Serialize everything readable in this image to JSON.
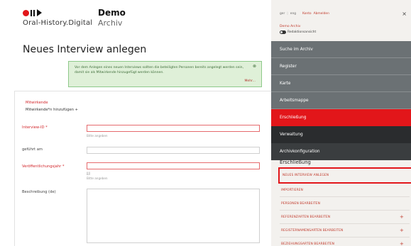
{
  "header": {
    "logo_text": "Oral-History.Digital",
    "archive_title": "Demo",
    "archive_subtitle": "Archiv"
  },
  "main": {
    "page_title": "Neues Interview anlegen",
    "notice": {
      "text": "Vor dem Anlegen eines neuen Interviews sollten die beteiligten Personen bereits angelegt werden sein, damit sie als Mitwirkende hinzugefügt werden können.",
      "more": "Mehr..."
    },
    "mitarbeitende": {
      "label": "Mitwirkende",
      "add_label": "Mitwirkende*n hinzufügen +"
    },
    "interview_id": {
      "label": "Interview-ID *",
      "value": "",
      "hint": "Bitte angeben"
    },
    "gefuehrt_am": {
      "label": "geführt am",
      "value": ""
    },
    "veroeffentlichungsjahr": {
      "label": "Veröffentlichungsjahr *",
      "value": "",
      "hint1": "JJJJ",
      "hint2": "Bitte angeben"
    },
    "beschreibung": {
      "label": "Beschreibung (de)",
      "value": ""
    }
  },
  "sidebar": {
    "lang_de": "ger",
    "lang_en": "eng",
    "login": "Konto",
    "logout": "Abmelden",
    "close": "×",
    "archive_name": "Demo Archiv",
    "toggle_label": "Redaktionsansicht",
    "nav": [
      {
        "label": "Suche im Archiv"
      },
      {
        "label": "Register"
      },
      {
        "label": "Karte"
      },
      {
        "label": "Arbeitsmappe"
      },
      {
        "label": "Erschließung"
      },
      {
        "label": "Verwaltung"
      },
      {
        "label": "Archivkonfiguration"
      }
    ],
    "subhead": "Erschließung",
    "subitems": [
      {
        "label": "NEUES INTERVIEW ANLEGEN",
        "plus": ""
      },
      {
        "label": "IMPORTIEREN",
        "plus": ""
      },
      {
        "label": "PERSONEN BEARBEITEN",
        "plus": ""
      },
      {
        "label": "REFERENZARTEN BEARBEITEN",
        "plus": "+"
      },
      {
        "label": "REGISTERNAMENSARTEN BEARBEITEN",
        "plus": "+"
      },
      {
        "label": "BEZIEHUNGSARTEN BEARBEITEN",
        "plus": "+"
      }
    ],
    "colors": {
      "accent": "#e2161a",
      "nav_grey": "#6b7174",
      "nav_dark": "#2a2c2e"
    }
  }
}
